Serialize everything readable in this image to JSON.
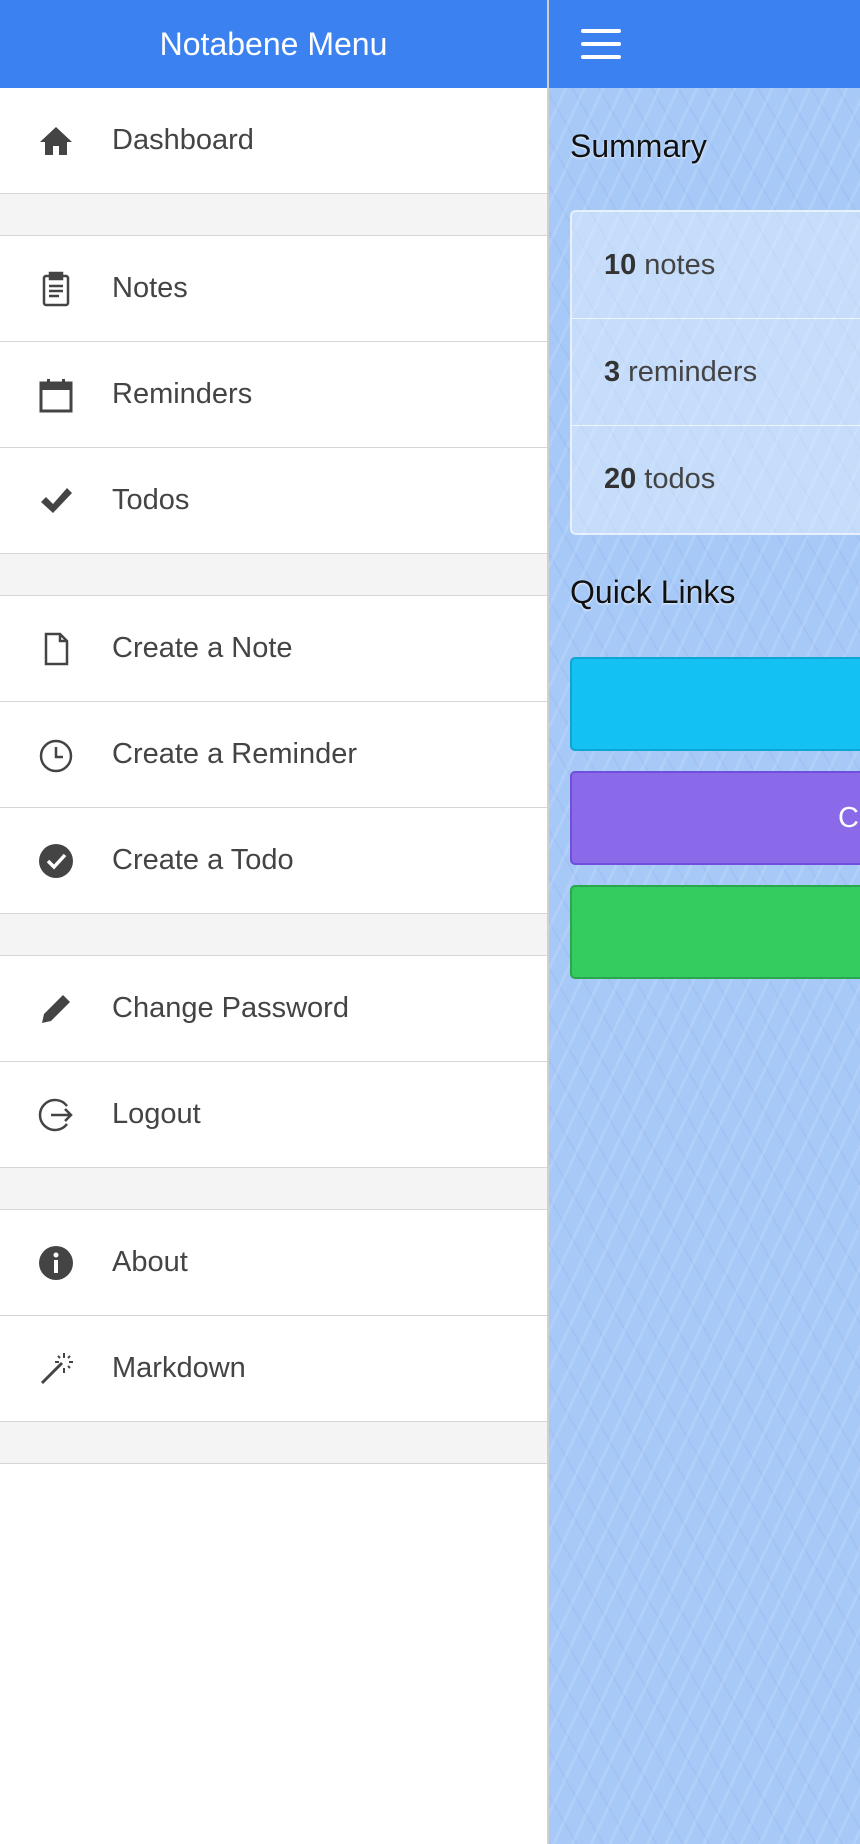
{
  "menu": {
    "title": "Notabene Menu",
    "items": [
      {
        "label": "Dashboard",
        "icon": "home-icon"
      },
      {
        "label": "Notes",
        "icon": "clipboard-icon"
      },
      {
        "label": "Reminders",
        "icon": "calendar-icon"
      },
      {
        "label": "Todos",
        "icon": "check-icon"
      },
      {
        "label": "Create a Note",
        "icon": "file-icon"
      },
      {
        "label": "Create a Reminder",
        "icon": "clock-icon"
      },
      {
        "label": "Create a Todo",
        "icon": "check-circle-icon"
      },
      {
        "label": "Change Password",
        "icon": "pencil-icon"
      },
      {
        "label": "Logout",
        "icon": "logout-icon"
      },
      {
        "label": "About",
        "icon": "info-icon"
      },
      {
        "label": "Markdown",
        "icon": "magic-wand-icon"
      }
    ]
  },
  "main": {
    "summary_title": "Summary",
    "summary": [
      {
        "count": "10",
        "label": "notes"
      },
      {
        "count": "3",
        "label": "reminders"
      },
      {
        "count": "20",
        "label": "todos"
      }
    ],
    "quick_links_title": "Quick Links",
    "quick_links": [
      {
        "label": "",
        "color": "#13c1f2"
      },
      {
        "label": "C",
        "color": "#8a6ae9"
      },
      {
        "label": "",
        "color": "#34cc5f"
      }
    ]
  }
}
